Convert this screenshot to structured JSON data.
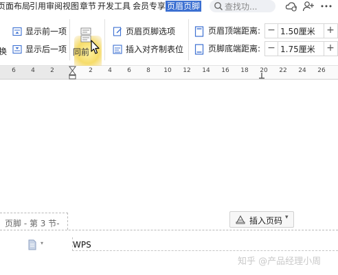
{
  "tabs": [
    {
      "label": "页面布局"
    },
    {
      "label": "引用"
    },
    {
      "label": "审阅"
    },
    {
      "label": "视图"
    },
    {
      "label": "章节"
    },
    {
      "label": "开发工具"
    },
    {
      "label": "会员专享"
    },
    {
      "label": "页眉页脚",
      "active": true
    }
  ],
  "search": {
    "placeholder": "查找功..."
  },
  "ribbon": {
    "cut_label": "换",
    "show_prev": "显示前一项",
    "show_next": "显示后一项",
    "same_as_prev": "同前",
    "hf_options": "页眉页脚选项",
    "insert_tab": "插入对齐制表位",
    "header_top_label": "页眉顶端距离:",
    "header_top_value": "1.50厘米",
    "footer_bottom_label": "页脚底端距离:",
    "footer_bottom_value": "1.75厘米",
    "minus": "−",
    "plus": "+"
  },
  "ruler": {
    "ticks": [
      "6",
      "4",
      "2",
      "2",
      "4",
      "6",
      "8",
      "10",
      "12",
      "14",
      "16",
      "18",
      "20",
      "22",
      "24",
      "26"
    ]
  },
  "footer": {
    "section_label": "页脚  - 第 3 节-",
    "insert_page_num": "插入页码",
    "content": "WPS"
  },
  "watermark": "知乎 @产品经理小周",
  "colors": {
    "accent": "#3b6fd1"
  }
}
